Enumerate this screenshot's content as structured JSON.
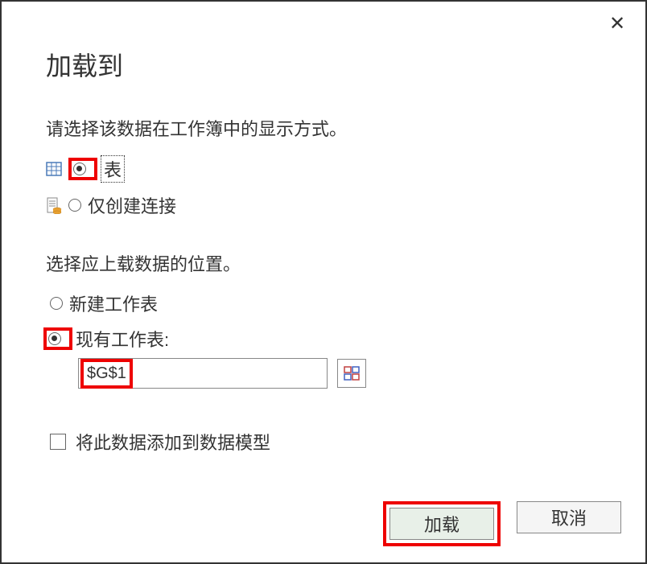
{
  "dialog": {
    "title": "加载到",
    "close": "✕"
  },
  "displayMode": {
    "label": "请选择该数据在工作簿中的显示方式。",
    "tableOption": "表",
    "connectionOption": "仅创建连接"
  },
  "location": {
    "label": "选择应上载数据的位置。",
    "newSheet": "新建工作表",
    "existingSheet": "现有工作表:",
    "cellValue": "$G$1"
  },
  "dataModel": {
    "label": "将此数据添加到数据模型"
  },
  "buttons": {
    "load": "加载",
    "cancel": "取消"
  }
}
